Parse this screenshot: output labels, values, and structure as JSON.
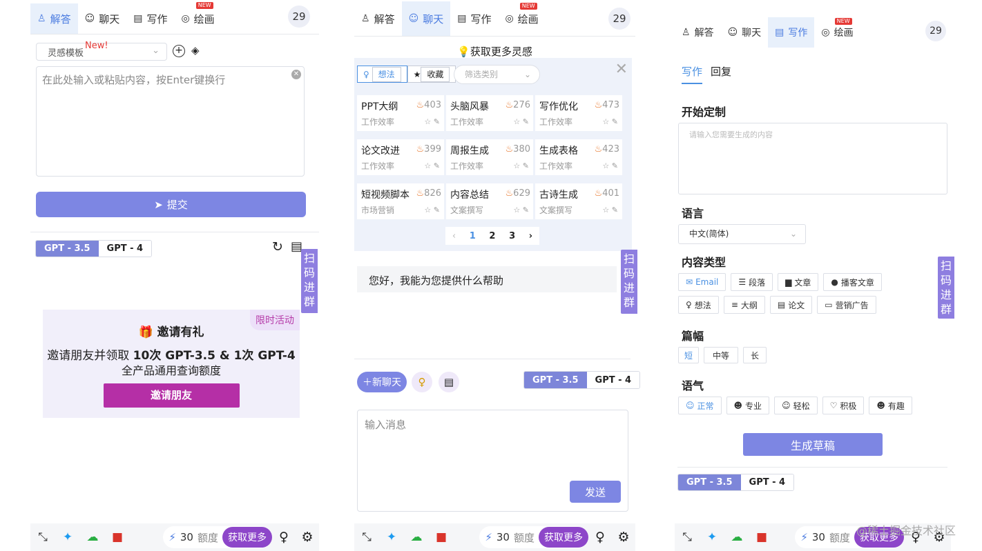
{
  "nav": {
    "tabs": [
      "解答",
      "聊天",
      "写作",
      "绘画"
    ],
    "new_badge": "NEW",
    "count": "29"
  },
  "model_switch": {
    "gpt35": "GPT - 3.5",
    "gpt4": "GPT - 4"
  },
  "side_tag": [
    "扫",
    "码",
    "进",
    "群"
  ],
  "bottom": {
    "quota": "30",
    "quota_unit": "额度",
    "get_more": "获取更多"
  },
  "panel1": {
    "template_select": "灵感模板",
    "template_new": "New!",
    "input_placeholder": "在此处输入或粘贴内容，按Enter键换行",
    "submit": "提交",
    "invite": {
      "tag": "限时活动",
      "title": "邀请有礼",
      "line1_prefix": "邀请朋友并领取 ",
      "line1_bold": "10次 GPT-3.5 & 1次 GPT-4",
      "line2": "全产品通用查询额度",
      "button": "邀请朋友"
    }
  },
  "panel2": {
    "inspire_title": "获取更多灵感",
    "filter_tabs": [
      "想法",
      "收藏"
    ],
    "category_placeholder": "筛选类别",
    "cards": [
      {
        "title": "PPT大纲",
        "category": "工作效率",
        "hot": "403"
      },
      {
        "title": "头脑风暴",
        "category": "工作效率",
        "hot": "276"
      },
      {
        "title": "写作优化",
        "category": "工作效率",
        "hot": "473"
      },
      {
        "title": "论文改进",
        "category": "工作效率",
        "hot": "399"
      },
      {
        "title": "周报生成",
        "category": "工作效率",
        "hot": "380"
      },
      {
        "title": "生成表格",
        "category": "工作效率",
        "hot": "423"
      },
      {
        "title": "短视频脚本",
        "category": "市场营销",
        "hot": "826"
      },
      {
        "title": "内容总结",
        "category": "文案撰写",
        "hot": "629"
      },
      {
        "title": "古诗生成",
        "category": "文案撰写",
        "hot": "401"
      }
    ],
    "pages": [
      "1",
      "2",
      "3"
    ],
    "greeting": "您好，我能为您提供什么帮助",
    "new_chat": "新聊天",
    "message_placeholder": "输入消息",
    "send": "发送"
  },
  "panel3": {
    "subtabs": [
      "写作",
      "回复"
    ],
    "custom_title": "开始定制",
    "custom_placeholder": "请输入您需要生成的内容",
    "language_title": "语言",
    "language_value": "中文(简体)",
    "content_type_title": "内容类型",
    "content_types": [
      "Email",
      "段落",
      "文章",
      "播客文章",
      "想法",
      "大纲",
      "论文",
      "营销广告"
    ],
    "length_title": "篇幅",
    "lengths": [
      "短",
      "中等",
      "长"
    ],
    "tone_title": "语气",
    "tones": [
      "正常",
      "专业",
      "轻松",
      "积极",
      "有趣"
    ],
    "generate": "生成草稿"
  },
  "watermark": "@稀土掘金技术社区"
}
